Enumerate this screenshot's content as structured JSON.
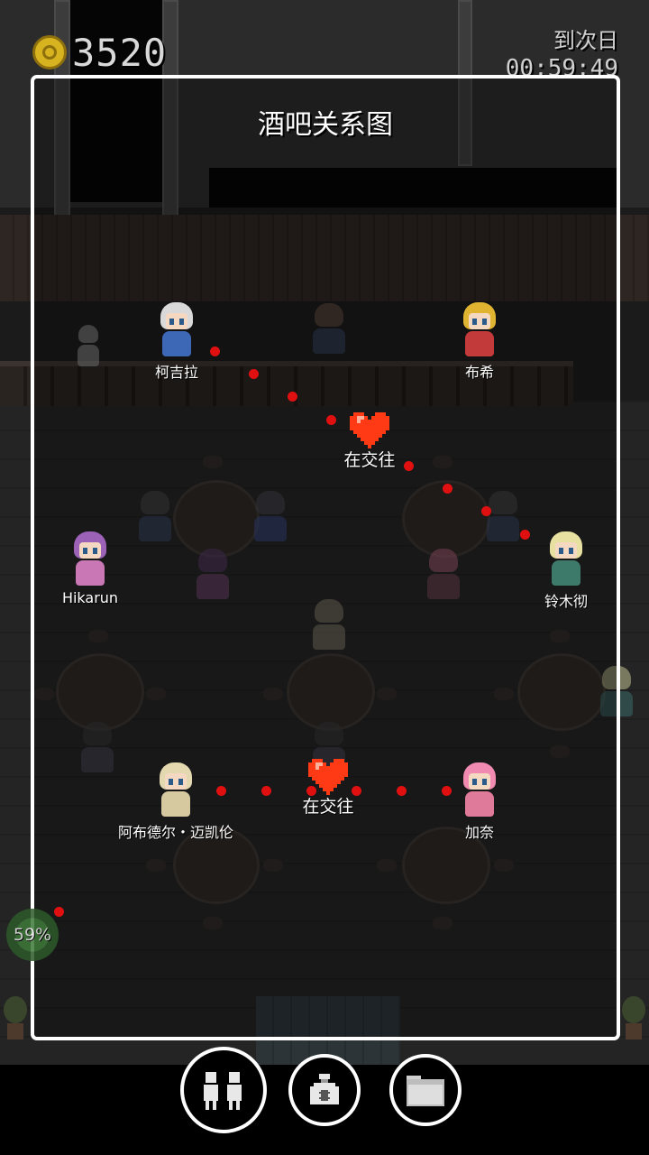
{
  "hud": {
    "coins": "3520",
    "timer_label": "到次日",
    "timer_value": "00:59:49"
  },
  "panel": {
    "title": "酒吧关系图"
  },
  "characters": [
    {
      "name": "柯吉拉",
      "hair": "#d9d9d9",
      "body": "#3d68b5"
    },
    {
      "name": "布希",
      "hair": "#e0b431",
      "body": "#c23a3a"
    },
    {
      "name": "Hikarun",
      "hair": "#9b62b8",
      "body": "#c978b5"
    },
    {
      "name": "铃木彻",
      "hair": "#e8e0a0",
      "body": "#3d7a6a"
    },
    {
      "name": "阿布德尔・迈凯伦",
      "hair": "#e3d8b0",
      "body": "#d6c9a0"
    },
    {
      "name": "加奈",
      "hair": "#f08ab0",
      "body": "#e07a9a"
    }
  ],
  "relations": [
    {
      "label": "在交往"
    },
    {
      "label": "在交往"
    }
  ],
  "progress": {
    "value": 0.59,
    "label": "59%"
  },
  "colors": {
    "accent": "#e01010",
    "heart": "#ff3a14",
    "border": "#ffffff"
  },
  "buttons": [
    {
      "icon": "relationship-people-icon"
    },
    {
      "icon": "money-bag-icon"
    },
    {
      "icon": "folder-icon"
    }
  ]
}
